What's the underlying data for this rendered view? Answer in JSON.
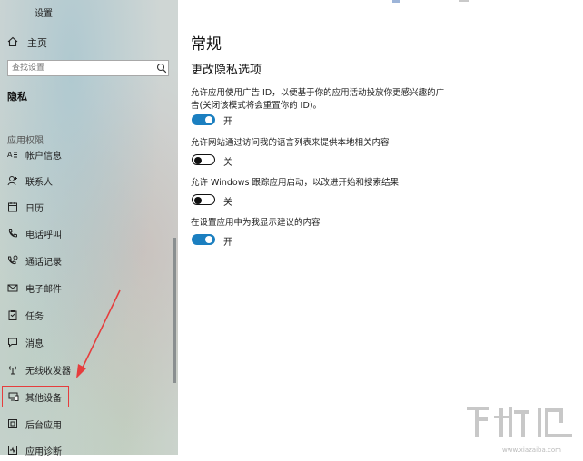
{
  "window": {
    "title": "设置"
  },
  "sidebar": {
    "home": {
      "label": "主页",
      "icon": "home-icon"
    },
    "search": {
      "placeholder": "查找设置",
      "icon": "search-icon"
    },
    "section_title": "隐私",
    "group_title": "应用权限",
    "items": [
      {
        "label": "帐户信息",
        "icon": "account-info-icon"
      },
      {
        "label": "联系人",
        "icon": "contacts-icon"
      },
      {
        "label": "日历",
        "icon": "calendar-icon"
      },
      {
        "label": "电话呼叫",
        "icon": "phone-icon"
      },
      {
        "label": "通话记录",
        "icon": "call-history-icon"
      },
      {
        "label": "电子邮件",
        "icon": "email-icon"
      },
      {
        "label": "任务",
        "icon": "tasks-icon"
      },
      {
        "label": "消息",
        "icon": "message-icon"
      },
      {
        "label": "无线收发器",
        "icon": "radio-icon"
      },
      {
        "label": "其他设备",
        "icon": "other-devices-icon",
        "highlighted": true
      },
      {
        "label": "后台应用",
        "icon": "background-apps-icon"
      },
      {
        "label": "应用诊断",
        "icon": "app-diagnostics-icon"
      }
    ]
  },
  "main": {
    "title": "常规",
    "subheading": "更改隐私选项",
    "settings": [
      {
        "description": "允许应用使用广告 ID，以便基于你的应用活动投放你更感兴趣的广告(关闭该模式将会重置你的 ID)。",
        "state_label": "开",
        "on": true
      },
      {
        "description": "允许网站通过访问我的语言列表来提供本地相关内容",
        "state_label": "关",
        "on": false
      },
      {
        "description": "允许 Windows 跟踪应用启动，以改进开始和搜索结果",
        "state_label": "关",
        "on": false
      },
      {
        "description": "在设置应用中为我显示建议的内容",
        "state_label": "开",
        "on": true
      }
    ]
  },
  "watermark": {
    "text": "www.xiazaiba.com"
  },
  "colors": {
    "accent": "#1b7fc0",
    "highlight_box": "#e63d3d"
  }
}
